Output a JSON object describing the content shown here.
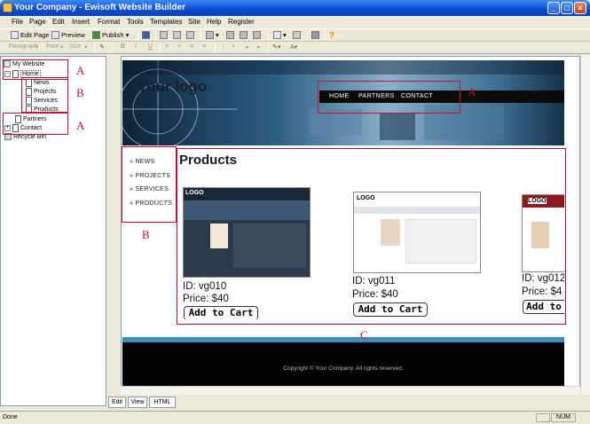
{
  "window": {
    "title": "Your Company - Ewisoft Website Builder"
  },
  "menu": [
    "File",
    "Page",
    "Edit",
    "Insert",
    "Format",
    "Tools",
    "Templates",
    "Site",
    "Help",
    "Register"
  ],
  "toolbar": {
    "edit_page": "Edit Page",
    "preview": "Preview",
    "publish": "Publish"
  },
  "format_toolbar": {
    "paragraph": "Paragraph",
    "font": "Font",
    "size": "Size",
    "bold": "B",
    "italic": "I",
    "underline": "U"
  },
  "tree": {
    "root": "My Website",
    "home": "Home",
    "news": "News",
    "projects": "Projects",
    "services": "Services",
    "products": "Products",
    "partners": "Partners",
    "contact": "Contact",
    "recycle": "Recycle Bin"
  },
  "annotations": {
    "a1": "A",
    "b1": "B",
    "a2": "A",
    "a3": "A",
    "b2": "B",
    "c": "C"
  },
  "site": {
    "logo": "Your logo",
    "nav": [
      "HOME",
      "PARTNERS",
      "CONTACT"
    ],
    "side": [
      "» NEWS",
      "» PROJECTS",
      "» SERVICES",
      "» PRODUCTS"
    ],
    "page_title": "Products",
    "products": [
      {
        "id": "ID: vg010",
        "price": "Price: $40",
        "cart": "Add to Cart"
      },
      {
        "id": "ID: vg011",
        "price": "Price: $40",
        "cart": "Add to Cart"
      },
      {
        "id": "ID: vg012",
        "price": "Price: $4",
        "cart": "Add to"
      }
    ],
    "thumb_logo": "LOGO",
    "copyright": "Copyright © Your Company.  All rights reserved."
  },
  "tabs": [
    "Edit",
    "View",
    "HTML"
  ],
  "status": {
    "left": "Done",
    "num": "NUM"
  },
  "colors": {
    "annotation": "#c8102e",
    "title_bar": "#0a4fd6"
  }
}
